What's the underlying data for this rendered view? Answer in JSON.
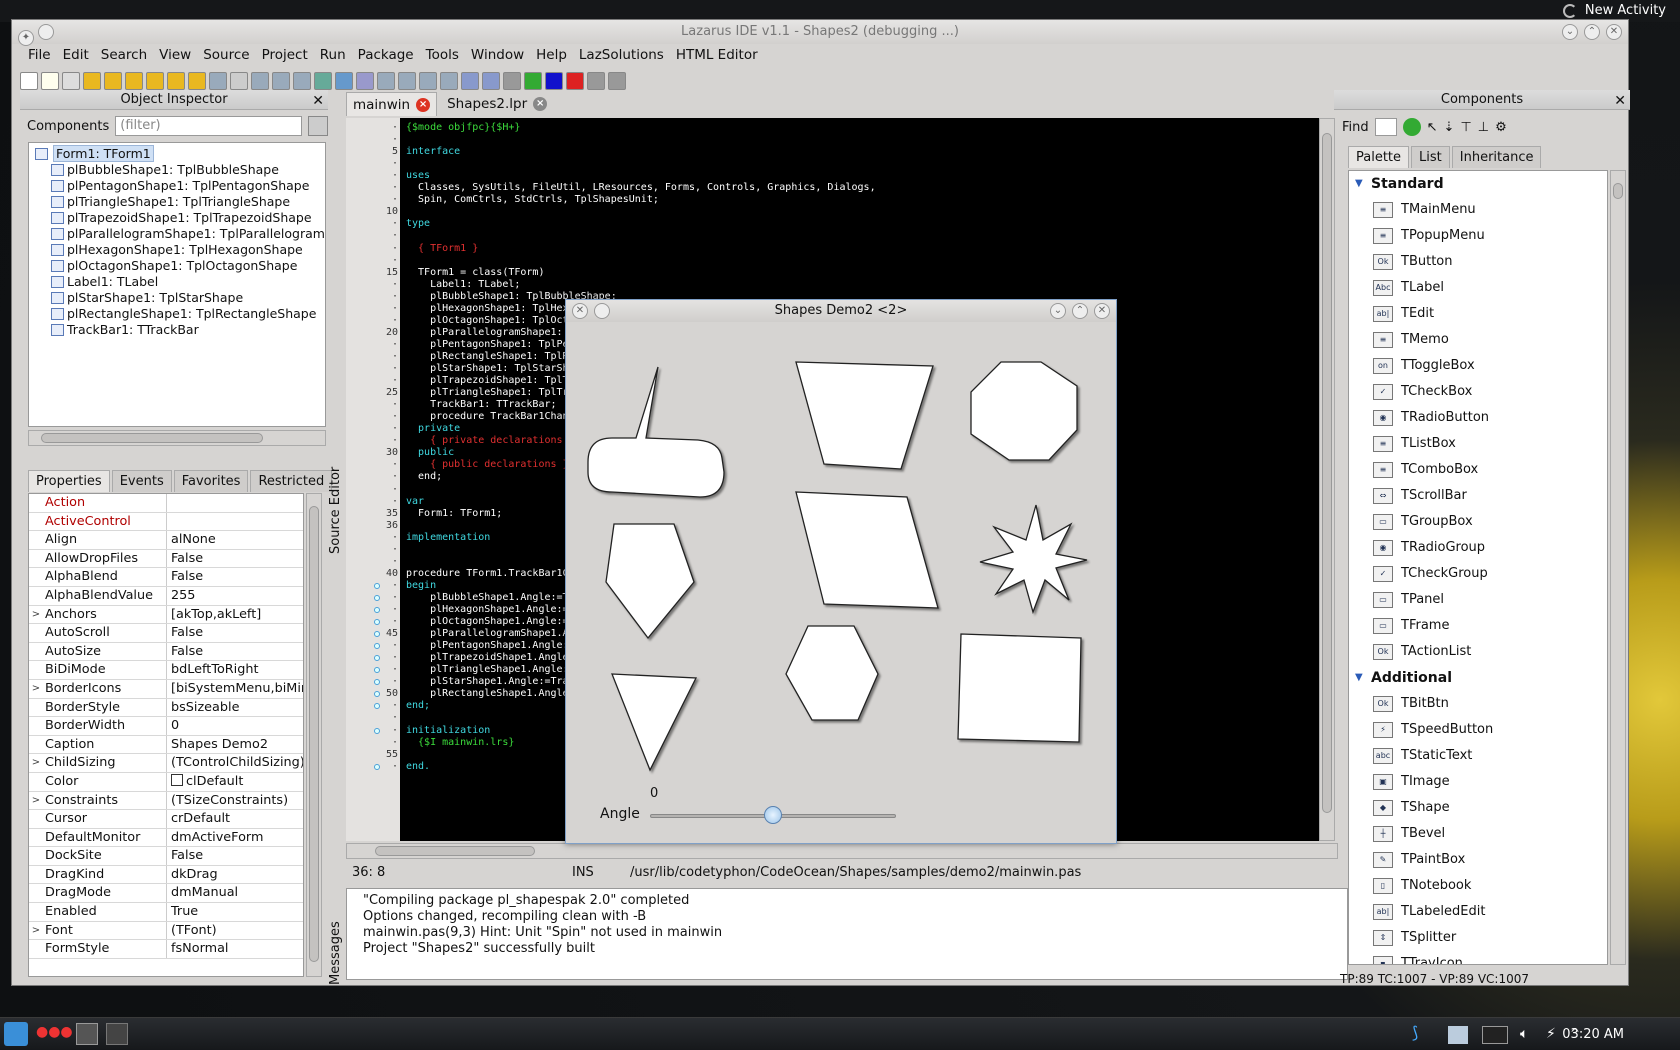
{
  "desktop": {
    "activity": "New Activity",
    "clock": "03:20 AM"
  },
  "window": {
    "title": "Lazarus IDE v1.1 - Shapes2 (debugging ...)"
  },
  "menu": [
    "File",
    "Edit",
    "Search",
    "View",
    "Source",
    "Project",
    "Run",
    "Package",
    "Tools",
    "Window",
    "Help",
    "LazSolutions",
    "HTML Editor"
  ],
  "object_inspector": {
    "title": "Object Inspector",
    "components_label": "Components",
    "filter_placeholder": "(filter)",
    "tree": [
      "Form1: TForm1",
      "plBubbleShape1: TplBubbleShape",
      "plPentagonShape1: TplPentagonShape",
      "plTriangleShape1: TplTriangleShape",
      "plTrapezoidShape1: TplTrapezoidShape",
      "plParallelogramShape1: TplParallelogramS",
      "plHexagonShape1: TplHexagonShape",
      "plOctagonShape1: TplOctagonShape",
      "Label1: TLabel",
      "plStarShape1: TplStarShape",
      "plRectangleShape1: TplRectangleShape",
      "TrackBar1: TTrackBar"
    ],
    "tabs": [
      "Properties",
      "Events",
      "Favorites",
      "Restricted"
    ],
    "properties": [
      {
        "name": "Action",
        "value": "",
        "exp": ""
      },
      {
        "name": "ActiveControl",
        "value": "",
        "exp": ""
      },
      {
        "name": "Align",
        "value": "alNone",
        "exp": ""
      },
      {
        "name": "AllowDropFiles",
        "value": "False",
        "exp": ""
      },
      {
        "name": "AlphaBlend",
        "value": "False",
        "exp": ""
      },
      {
        "name": "AlphaBlendValue",
        "value": "255",
        "exp": ""
      },
      {
        "name": "Anchors",
        "value": "[akTop,akLeft]",
        "exp": ">"
      },
      {
        "name": "AutoScroll",
        "value": "False",
        "exp": ""
      },
      {
        "name": "AutoSize",
        "value": "False",
        "exp": ""
      },
      {
        "name": "BiDiMode",
        "value": "bdLeftToRight",
        "exp": ""
      },
      {
        "name": "BorderIcons",
        "value": "[biSystemMenu,biMinim",
        "exp": ">"
      },
      {
        "name": "BorderStyle",
        "value": "bsSizeable",
        "exp": ""
      },
      {
        "name": "BorderWidth",
        "value": "0",
        "exp": ""
      },
      {
        "name": "Caption",
        "value": "Shapes Demo2",
        "exp": ""
      },
      {
        "name": "ChildSizing",
        "value": "(TControlChildSizing)",
        "exp": ">"
      },
      {
        "name": "Color",
        "value": "clDefault",
        "exp": ""
      },
      {
        "name": "Constraints",
        "value": "(TSizeConstraints)",
        "exp": ">"
      },
      {
        "name": "Cursor",
        "value": "crDefault",
        "exp": ""
      },
      {
        "name": "DefaultMonitor",
        "value": "dmActiveForm",
        "exp": ""
      },
      {
        "name": "DockSite",
        "value": "False",
        "exp": ""
      },
      {
        "name": "DragKind",
        "value": "dkDrag",
        "exp": ""
      },
      {
        "name": "DragMode",
        "value": "dmManual",
        "exp": ""
      },
      {
        "name": "Enabled",
        "value": "True",
        "exp": ""
      },
      {
        "name": "Font",
        "value": "(TFont)",
        "exp": ">"
      },
      {
        "name": "FormStyle",
        "value": "fsNormal",
        "exp": ""
      }
    ]
  },
  "editor": {
    "side_label": "Source Editor",
    "tabs": [
      "mainwin",
      "Shapes2.lpr"
    ],
    "gutter_numbers": [
      {
        "n": "5",
        "line": 2
      },
      {
        "n": "10",
        "line": 7
      },
      {
        "n": "15",
        "line": 12
      },
      {
        "n": "20",
        "line": 17
      },
      {
        "n": "25",
        "line": 22
      },
      {
        "n": "30",
        "line": 27
      },
      {
        "n": "35",
        "line": 32
      },
      {
        "n": "36",
        "line": 33
      },
      {
        "n": "40",
        "line": 37
      },
      {
        "n": "45",
        "line": 42
      },
      {
        "n": "50",
        "line": 47
      },
      {
        "n": "55",
        "line": 52
      },
      {
        "n": "57",
        "line": 54
      }
    ],
    "lines": [
      {
        "t": "{$mode objfpc}{$H+}",
        "c": "cg"
      },
      {
        "t": "",
        "c": ""
      },
      {
        "t": "interface",
        "c": "cc"
      },
      {
        "t": "",
        "c": ""
      },
      {
        "t": "uses",
        "c": "cc"
      },
      {
        "t": "  Classes, SysUtils, FileUtil, LResources, Forms, Controls, Graphics, Dialogs,",
        "c": ""
      },
      {
        "t": "  Spin, ComCtrls, StdCtrls, TplShapesUnit;",
        "c": ""
      },
      {
        "t": "",
        "c": ""
      },
      {
        "t": "type",
        "c": "cc"
      },
      {
        "t": "",
        "c": ""
      },
      {
        "t": "  { TForm1 }",
        "c": "cr"
      },
      {
        "t": "",
        "c": ""
      },
      {
        "t": "  TForm1 = class(TForm)",
        "c": ""
      },
      {
        "t": "    Label1: TLabel;",
        "c": ""
      },
      {
        "t": "    plBubbleShape1: TplBubbleShape;",
        "c": ""
      },
      {
        "t": "    plHexagonShape1: TplHexagonShape;",
        "c": ""
      },
      {
        "t": "    plOctagonShape1: TplOctagonShape;",
        "c": ""
      },
      {
        "t": "    plParallelogramShape1: TplParallelogramShape;",
        "c": ""
      },
      {
        "t": "    plPentagonShape1: TplPentagonShape;",
        "c": ""
      },
      {
        "t": "    plRectangleShape1: TplRectangleShape;",
        "c": ""
      },
      {
        "t": "    plStarShape1: TplStarShape;",
        "c": ""
      },
      {
        "t": "    plTrapezoidShape1: TplTrapezoidShape;",
        "c": ""
      },
      {
        "t": "    plTriangleShape1: TplTriangleShape;",
        "c": ""
      },
      {
        "t": "    TrackBar1: TTrackBar;",
        "c": ""
      },
      {
        "t": "    procedure TrackBar1Change(Sender: TObject);",
        "c": ""
      },
      {
        "t": "  private",
        "c": "cc"
      },
      {
        "t": "    { private declarations }",
        "c": "cr"
      },
      {
        "t": "  public",
        "c": "cc"
      },
      {
        "t": "    { public declarations }",
        "c": "cr"
      },
      {
        "t": "  end;",
        "c": ""
      },
      {
        "t": "",
        "c": ""
      },
      {
        "t": "var",
        "c": "cc"
      },
      {
        "t": "  Form1: TForm1;",
        "c": ""
      },
      {
        "t": "",
        "c": ""
      },
      {
        "t": "implementation",
        "c": "cc"
      },
      {
        "t": "",
        "c": ""
      },
      {
        "t": "",
        "c": ""
      },
      {
        "t": "procedure TForm1.TrackBar1Change(Sender: TObject);",
        "c": ""
      },
      {
        "t": "begin",
        "c": "cc"
      },
      {
        "t": "    plBubbleShape1.Angle:=TrackBar1.Position;",
        "c": ""
      },
      {
        "t": "    plHexagonShape1.Angle:=TrackBar1.Position;",
        "c": ""
      },
      {
        "t": "    plOctagonShape1.Angle:=TrackBar1.Position;",
        "c": ""
      },
      {
        "t": "    plParallelogramShape1.Angle:=TrackBar1.Position;",
        "c": ""
      },
      {
        "t": "    plPentagonShape1.Angle:=TrackBar1.Position;",
        "c": ""
      },
      {
        "t": "    plTrapezoidShape1.Angle:=TrackBar1.Position;",
        "c": ""
      },
      {
        "t": "    plTriangleShape1.Angle:=TrackBar1.Position;",
        "c": ""
      },
      {
        "t": "    plStarShape1.Angle:=TrackBar1.Position;",
        "c": ""
      },
      {
        "t": "    plRectangleShape1.Angle:=TrackBar1.Position;",
        "c": ""
      },
      {
        "t": "end;",
        "c": "cc"
      },
      {
        "t": "",
        "c": ""
      },
      {
        "t": "initialization",
        "c": "cc"
      },
      {
        "t": "  {$I mainwin.lrs}",
        "c": "cg"
      },
      {
        "t": "",
        "c": ""
      },
      {
        "t": "end.",
        "c": "cc"
      }
    ],
    "status": {
      "pos": "36:  8",
      "mode": "INS",
      "path": "/usr/lib/codetyphon/CodeOcean/Shapes/samples/demo2/mainwin.pas"
    }
  },
  "messages": {
    "side_label": "Messages",
    "items": [
      "\"Compiling package pl_shapespak 2.0\" completed",
      "Options changed, recompiling clean with -B",
      "mainwin.pas(9,3) Hint: Unit \"Spin\" not used in mainwin",
      "Project \"Shapes2\" successfully built"
    ]
  },
  "components": {
    "title": "Components",
    "find_label": "Find",
    "tabs": [
      "Palette",
      "List",
      "Inheritance"
    ],
    "categories": [
      {
        "name": "Standard",
        "items": [
          {
            "label": "TMainMenu",
            "ico": "≡"
          },
          {
            "label": "TPopupMenu",
            "ico": "≡"
          },
          {
            "label": "TButton",
            "ico": "Ok"
          },
          {
            "label": "TLabel",
            "ico": "Abc"
          },
          {
            "label": "TEdit",
            "ico": "ab|"
          },
          {
            "label": "TMemo",
            "ico": "≡"
          },
          {
            "label": "TToggleBox",
            "ico": "on"
          },
          {
            "label": "TCheckBox",
            "ico": "✓"
          },
          {
            "label": "TRadioButton",
            "ico": "◉"
          },
          {
            "label": "TListBox",
            "ico": "≡"
          },
          {
            "label": "TComboBox",
            "ico": "≡"
          },
          {
            "label": "TScrollBar",
            "ico": "⇔"
          },
          {
            "label": "TGroupBox",
            "ico": "▭"
          },
          {
            "label": "TRadioGroup",
            "ico": "◉"
          },
          {
            "label": "TCheckGroup",
            "ico": "✓"
          },
          {
            "label": "TPanel",
            "ico": "▭"
          },
          {
            "label": "TFrame",
            "ico": "▭"
          },
          {
            "label": "TActionList",
            "ico": "Ok"
          }
        ]
      },
      {
        "name": "Additional",
        "items": [
          {
            "label": "TBitBtn",
            "ico": "Ok"
          },
          {
            "label": "TSpeedButton",
            "ico": "⚡"
          },
          {
            "label": "TStaticText",
            "ico": "abc"
          },
          {
            "label": "TImage",
            "ico": "▣"
          },
          {
            "label": "TShape",
            "ico": "◆"
          },
          {
            "label": "TBevel",
            "ico": "┼"
          },
          {
            "label": "TPaintBox",
            "ico": "✎"
          },
          {
            "label": "TNotebook",
            "ico": "▯"
          },
          {
            "label": "TLabeledEdit",
            "ico": "ab|"
          },
          {
            "label": "TSplitter",
            "ico": "⇕"
          },
          {
            "label": "TTrayIcon",
            "ico": "▪"
          }
        ]
      }
    ],
    "status": "TP:89 TC:1007 - VP:89 VC:1007"
  },
  "demo": {
    "title": "Shapes Demo2 <2>",
    "angle_label": "Angle",
    "angle_value": "0",
    "slider_fraction": 0.5
  }
}
